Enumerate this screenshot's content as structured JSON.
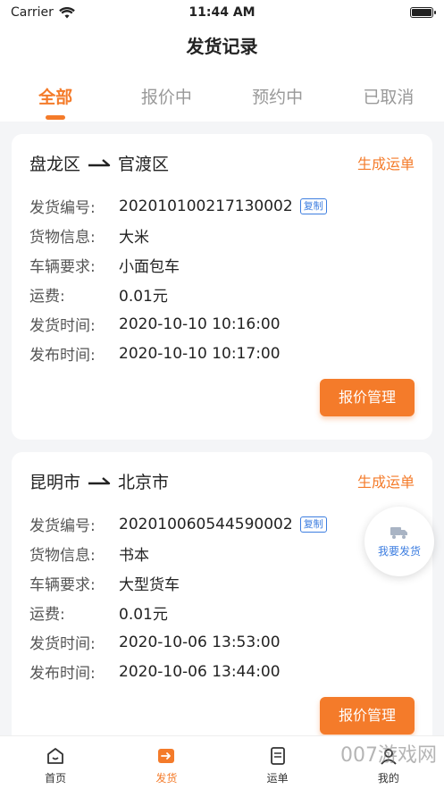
{
  "status_bar": {
    "carrier": "Carrier",
    "time": "11:44 AM"
  },
  "nav": {
    "title": "发货记录"
  },
  "tabs": [
    {
      "label": "全部",
      "active": true
    },
    {
      "label": "报价中",
      "active": false
    },
    {
      "label": "预约中",
      "active": false
    },
    {
      "label": "已取消",
      "active": false
    }
  ],
  "labels": {
    "order_no": "发货编号:",
    "goods": "货物信息:",
    "vehicle": "车辆要求:",
    "fee": "运费:",
    "ship_time": "发货时间:",
    "publish_time": "发布时间:",
    "copy": "复制",
    "generate": "生成运单",
    "quote_mgmt": "报价管理"
  },
  "orders": [
    {
      "from": "盘龙区",
      "to": "官渡区",
      "order_no": "202010100217130002",
      "goods": "大米",
      "vehicle": "小面包车",
      "fee": "0.01元",
      "ship_time": "2020-10-10 10:16:00",
      "publish_time": "2020-10-10 10:17:00"
    },
    {
      "from": "昆明市",
      "to": "北京市",
      "order_no": "202010060544590002",
      "goods": "书本",
      "vehicle": "大型货车",
      "fee": "0.01元",
      "ship_time": "2020-10-06 13:53:00",
      "publish_time": "2020-10-06 13:44:00"
    }
  ],
  "float_button": {
    "label": "我要发货",
    "icon": "truck-icon"
  },
  "tabbar": [
    {
      "label": "首页",
      "icon": "home-icon",
      "active": false
    },
    {
      "label": "发货",
      "icon": "ship-icon",
      "active": true
    },
    {
      "label": "运单",
      "icon": "waybill-icon",
      "active": false
    },
    {
      "label": "我的",
      "icon": "profile-icon",
      "active": false
    }
  ],
  "watermark": "007游戏网",
  "colors": {
    "accent": "#f47b2a",
    "link": "#3d7ee0"
  }
}
